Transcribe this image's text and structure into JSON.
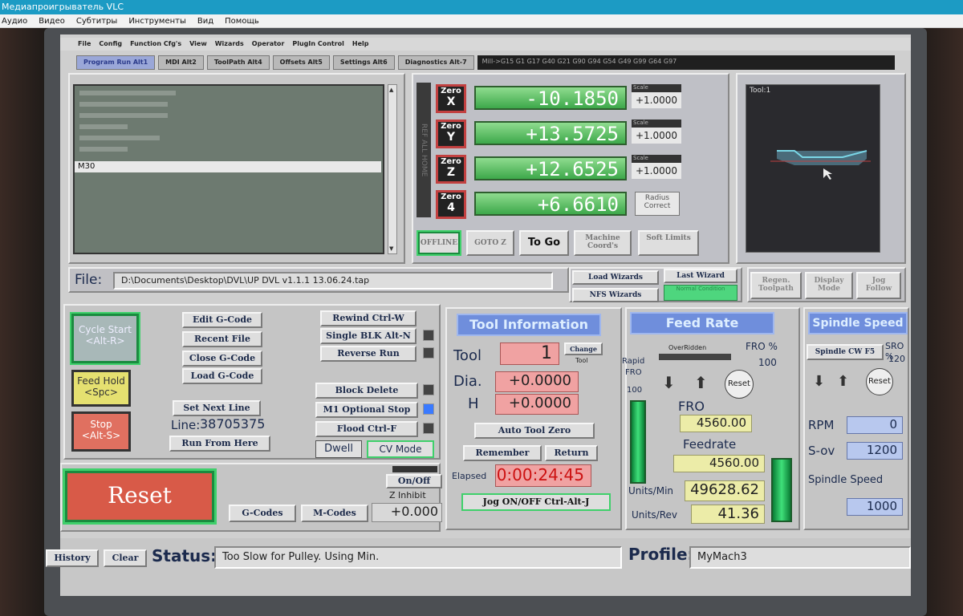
{
  "window": {
    "title": "Медиапроигрыватель VLC"
  },
  "menu": [
    "Аудио",
    "Видео",
    "Субтитры",
    "Инструменты",
    "Вид",
    "Помощь"
  ],
  "mach_menu": [
    "File",
    "Config",
    "Function Cfg's",
    "View",
    "Wizards",
    "Operator",
    "PlugIn Control",
    "Help"
  ],
  "tabs": [
    "Program Run Alt1",
    "MDI Alt2",
    "ToolPath Alt4",
    "Offsets Alt5",
    "Settings Alt6",
    "Diagnostics Alt-7"
  ],
  "modal_line": "Mill->G15  G1 G17 G40 G21 G90 G94 G54 G49 G99 G64 G97",
  "gcode": {
    "current_line": "M30"
  },
  "axes": [
    {
      "zero": "Zero",
      "axis": "X",
      "value": "-10.1850",
      "scale_label": "Scale",
      "scale": "+1.0000"
    },
    {
      "zero": "Zero",
      "axis": "Y",
      "value": "+13.5725",
      "scale_label": "Scale",
      "scale": "+1.0000"
    },
    {
      "zero": "Zero",
      "axis": "Z",
      "value": "+12.6525",
      "scale_label": "Scale",
      "scale": "+1.0000"
    },
    {
      "zero": "Zero",
      "axis": "4",
      "value": "+6.6610",
      "scale_label": "Radius",
      "scale": "Correct"
    }
  ],
  "ref_all_home": "REF ALL HOME",
  "dro_buttons": {
    "offline": "OFFLINE",
    "goto_z": "GOTO Z",
    "to_go": "To Go",
    "machine_coords": "Machine Coord's",
    "soft_limits": "Soft Limits"
  },
  "toolpath": {
    "label": "Tool:1"
  },
  "file": {
    "label": "File:",
    "path": "D:\\Documents\\Desktop\\DVL\\UP DVL v1.1.1 13.06.24.tap"
  },
  "wizards": {
    "load": "Load Wizards",
    "last": "Last Wizard",
    "nfs": "NFS Wizards",
    "normal": "Normal Condition"
  },
  "view_buttons": {
    "regen": "Regen. Toolpath",
    "display": "Display Mode",
    "jog": "Jog Follow"
  },
  "program_controls": {
    "cycle_start": "Cycle Start",
    "cycle_start_key": "<Alt-R>",
    "feed_hold": "Feed Hold",
    "feed_hold_key": "<Spc>",
    "stop": "Stop",
    "stop_key": "<Alt-S>",
    "edit": "Edit G-Code",
    "recent": "Recent File",
    "close": "Close G-Code",
    "load": "Load G-Code",
    "set_next": "Set Next Line",
    "line_label": "Line:",
    "line_value": "38705375",
    "run_from": "Run From Here",
    "rewind": "Rewind Ctrl-W",
    "single_blk": "Single BLK Alt-N",
    "reverse": "Reverse Run",
    "block_delete": "Block Delete",
    "m1_stop": "M1 Optional Stop",
    "flood": "Flood Ctrl-F",
    "dwell": "Dwell",
    "cv_mode": "CV Mode"
  },
  "reset_area": {
    "reset": "Reset",
    "gcodes": "G-Codes",
    "mcodes": "M-Codes",
    "on_off": "On/Off",
    "z_inhibit": "Z Inhibit",
    "z_value": "+0.000"
  },
  "tool_info": {
    "header": "Tool Information",
    "tool_label": "Tool",
    "tool_value": "1",
    "change": "Change",
    "tool_small": "Tool",
    "dia_label": "Dia.",
    "dia_value": "+0.0000",
    "h_label": "H",
    "h_value": "+0.0000",
    "auto_zero": "Auto Tool Zero",
    "remember": "Remember",
    "return": "Return",
    "elapsed_label": "Elapsed",
    "elapsed": "0:00:24:45",
    "jog": "Jog ON/OFF Ctrl-Alt-J"
  },
  "feed": {
    "header": "Feed Rate",
    "overridden": "OverRidden",
    "fro_pct_label": "FRO %",
    "fro_pct": "100",
    "rapid": "Rapid",
    "rapid_fro": "FRO",
    "rapid_value": "100",
    "reset": "Reset",
    "fro_label": "FRO",
    "fro_value": "4560.00",
    "feedrate_label": "Feedrate",
    "feedrate_value": "4560.00",
    "units_min_label": "Units/Min",
    "units_min_value": "49628.62",
    "units_rev_label": "Units/Rev",
    "units_rev_value": "41.36"
  },
  "spindle": {
    "header": "Spindle Speed",
    "cw": "Spindle CW F5",
    "sro_label": "SRO %",
    "sro_value": "120",
    "reset": "Reset",
    "rpm_label": "RPM",
    "rpm_value": "0",
    "sov_label": "S-ov",
    "sov_value": "1200",
    "speed_label": "Spindle Speed",
    "speed_value": "1000"
  },
  "statusbar": {
    "history": "History",
    "clear": "Clear",
    "status_label": "Status:",
    "status": "Too Slow for Pulley. Using Min.",
    "profile_label": "Profile:",
    "profile": "MyMach3"
  }
}
